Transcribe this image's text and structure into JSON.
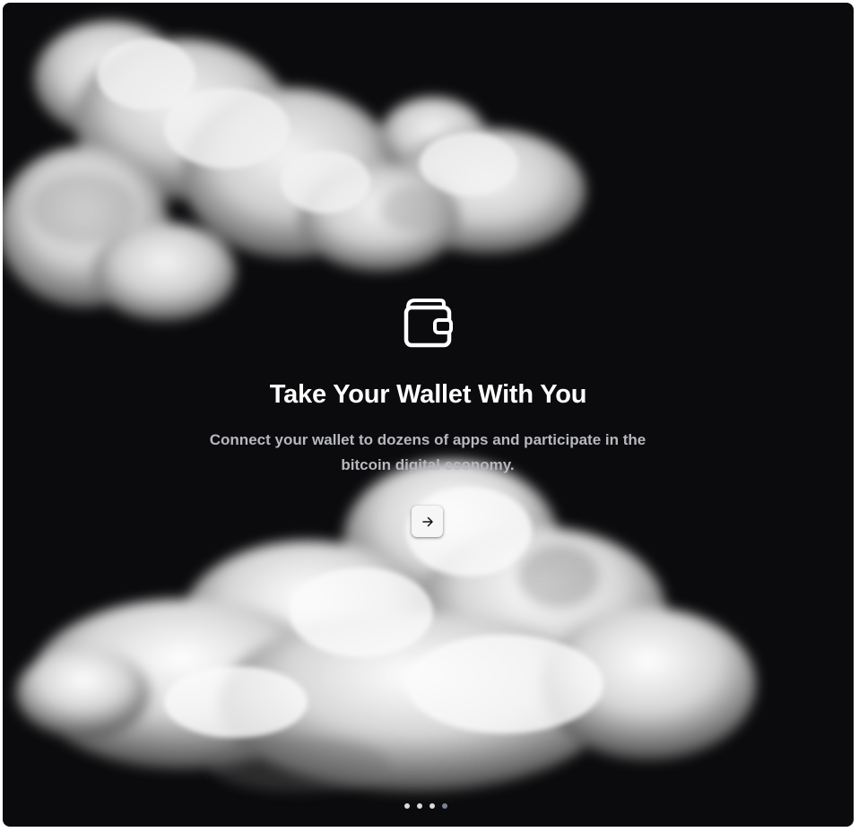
{
  "onboarding": {
    "title": "Take Your Wallet With You",
    "subtitle": "Connect your wallet to dozens of apps and participate in the bitcoin digital economy.",
    "next_icon": "arrow-right-icon",
    "hero_icon": "wallet-icon",
    "background_image": "clouds",
    "pagination": {
      "total": 4,
      "active_index": 4
    }
  },
  "colors": {
    "background": "#0b0b0d",
    "title": "#ffffff",
    "subtitle": "#b7b9be",
    "button": "#f6f6f7",
    "dot": "#d9d9de",
    "dot_active": "#7a8194"
  }
}
